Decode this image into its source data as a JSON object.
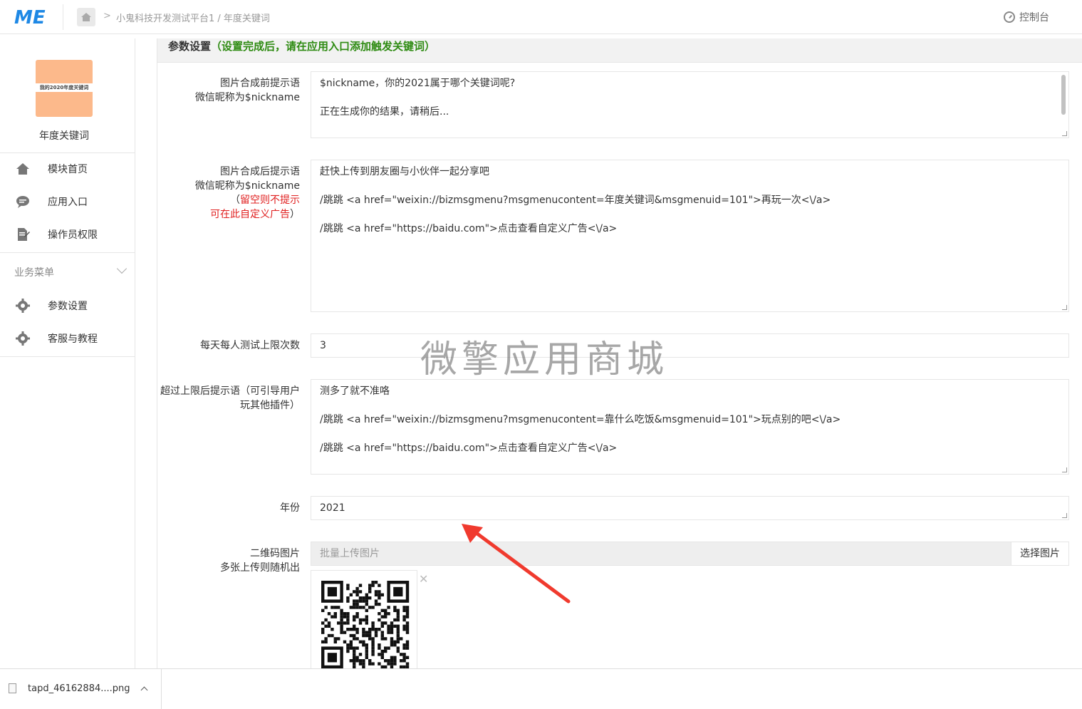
{
  "header": {
    "logo_text": "ME",
    "breadcrumb": "小鬼科技开发测试平台1 / 年度关键词",
    "console_label": "控制台"
  },
  "sidebar": {
    "app_name": "年度关键词",
    "app_thumb_text": "我的2020年度关键词",
    "nav": [
      {
        "label": "模块首页",
        "icon": "home-icon"
      },
      {
        "label": "应用入口",
        "icon": "chat-bubble-icon"
      },
      {
        "label": "操作员权限",
        "icon": "edit-document-icon"
      }
    ],
    "section_title": "业务菜单",
    "business_menu": [
      {
        "label": "参数设置",
        "icon": "gear-icon"
      },
      {
        "label": "客服与教程",
        "icon": "gear-icon"
      }
    ]
  },
  "panel": {
    "title": "参数设置",
    "hint": "（设置完成后，请在应用入口添加触发关键词）"
  },
  "form": {
    "before_prompt": {
      "label_line1": "图片合成前提示语",
      "label_line2": "微信昵称为$nickname",
      "lines": [
        "$nickname，你的2021属于哪个关键词呢?",
        "正在生成你的结果，请稍后..."
      ]
    },
    "after_prompt": {
      "label_line1": "图片合成后提示语",
      "label_line2": "微信昵称为$nickname",
      "label_line3_prefix": "（",
      "label_line3_red": "留空则不提示",
      "label_line4_red": "可在此自定义广告",
      "label_line4_suffix": "）",
      "lines": [
        "赶快上传到朋友圈与小伙伴一起分享吧",
        "/跳跳  <a href=\"weixin://bizmsgmenu?msgmenucontent=年度关键词&msgmenuid=101\">再玩一次<\\/a>",
        "/跳跳  <a href=\"https://baidu.com\">点击查看自定义广告<\\/a>"
      ]
    },
    "daily_limit": {
      "label": "每天每人测试上限次数",
      "value": "3"
    },
    "over_limit": {
      "label_line1": "超过上限后提示语（可引导用户",
      "label_line2": "玩其他插件）",
      "lines": [
        "测多了就不准咯",
        "/跳跳  <a href=\"weixin://bizmsgmenu?msgmenucontent=靠什么吃饭&msgmenuid=101\">玩点别的吧<\\/a>",
        "/跳跳  <a href=\"https://baidu.com\">点击查看自定义广告<\\/a>"
      ]
    },
    "year": {
      "label": "年份",
      "value": "2021"
    },
    "qrcode": {
      "label_line1": "二维码图片",
      "label_line2": "多张上传则随机出",
      "placeholder": "批量上传图片",
      "button": "选择图片"
    }
  },
  "watermark": "微擎应用商城",
  "download": {
    "filename": "tapd_46162884....png"
  }
}
